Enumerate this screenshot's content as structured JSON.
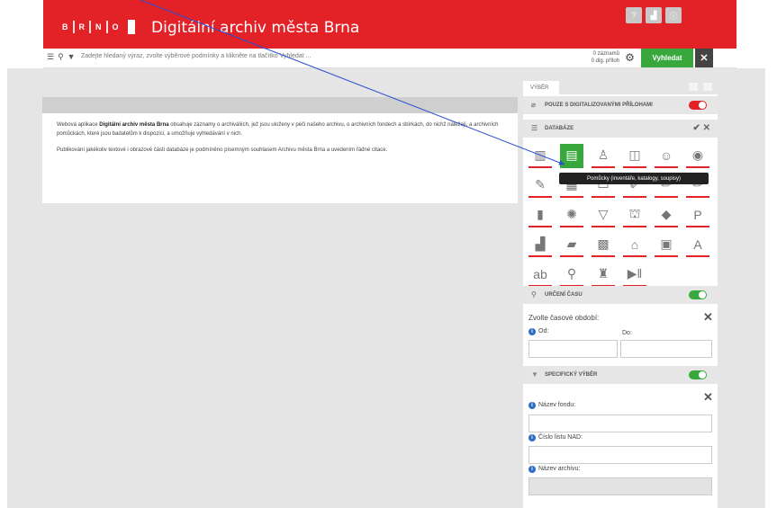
{
  "header": {
    "logo": [
      "B",
      "R",
      "N",
      "O"
    ],
    "title": "Digitální archiv města Brna",
    "icons": [
      "help-icon",
      "stats-icon",
      "info-icon"
    ]
  },
  "search": {
    "placeholder": "Zadejte hledaný výraz, zvolte výběrové podmínky a klikněte na tlačítko Vyhledat ...",
    "records": "0 záznamů",
    "attachments": "0 dig. příloh",
    "button": "Vyhledat",
    "close": "✕"
  },
  "intro": {
    "p1_a": "Webová aplikace ",
    "p1_b": "Digitální archiv města Brna",
    "p1_c": " obsahuje záznamy o archiváliích, jež jsou uloženy v péči našeho archivu, o archivních fondech a sbírkách, do nichž náležejí, a archivních pomůckách, které jsou badatelům k dispozici, a umožňuje vyhledávání v nich.",
    "p2": "Publikování jakékoliv textové i obrazové části databáze je podmíněno písemným souhlasem Archivu města Brna a uvedením řádné citace."
  },
  "panel": {
    "tab": "VÝBĚR",
    "digital_only": "POUZE S DIGITALIZOVANÝMI PŘÍLOHAMI",
    "databases": "DATABÁZE",
    "tooltip": "Pomůcky (inventáře, katalogy, soupisy)",
    "db_icons": [
      {
        "icon": "archive-icon",
        "glyph": "▥",
        "active": false
      },
      {
        "icon": "document-icon",
        "glyph": "▤",
        "active": true
      },
      {
        "icon": "person-icon",
        "glyph": "♙",
        "active": false
      },
      {
        "icon": "card-icon",
        "glyph": "◫",
        "active": false
      },
      {
        "icon": "people-icon",
        "glyph": "☺",
        "active": false
      },
      {
        "icon": "camera-icon",
        "glyph": "◉",
        "active": false
      },
      {
        "icon": "brush-icon",
        "glyph": "✎",
        "active": false
      },
      {
        "icon": "stack-icon",
        "glyph": "▦",
        "active": false
      },
      {
        "icon": "box-icon",
        "glyph": "▭",
        "active": false
      },
      {
        "icon": "pen-icon",
        "glyph": "✐",
        "active": false
      },
      {
        "icon": "pencil-icon",
        "glyph": "✏",
        "active": false
      },
      {
        "icon": "pencil-8k-icon",
        "glyph": "✏",
        "active": false
      },
      {
        "icon": "scroll-icon",
        "glyph": "▮",
        "active": false
      },
      {
        "icon": "seal-icon",
        "glyph": "✺",
        "active": false
      },
      {
        "icon": "badge-icon",
        "glyph": "▽",
        "active": false
      },
      {
        "icon": "gate-icon",
        "glyph": "⛫",
        "active": false
      },
      {
        "icon": "emblem-icon",
        "glyph": "◆",
        "active": false
      },
      {
        "icon": "poster-p-icon",
        "glyph": "P",
        "active": false
      },
      {
        "icon": "map-icon",
        "glyph": "▟",
        "active": false
      },
      {
        "icon": "book-icon",
        "glyph": "▰",
        "active": false
      },
      {
        "icon": "plan-icon",
        "glyph": "▩",
        "active": false
      },
      {
        "icon": "building-icon",
        "glyph": "⌂",
        "active": false
      },
      {
        "icon": "frame-icon",
        "glyph": "▣",
        "active": false
      },
      {
        "icon": "letter-a-icon",
        "glyph": "A",
        "active": false
      },
      {
        "icon": "handwriting-icon",
        "glyph": "ab",
        "active": false
      },
      {
        "icon": "tool-icon",
        "glyph": "⚲",
        "active": false
      },
      {
        "icon": "stamp-icon",
        "glyph": "♜",
        "active": false
      },
      {
        "icon": "media-play-icon",
        "glyph": "▶‖",
        "active": false
      }
    ],
    "time": "URČENÍ ČASU",
    "time_hint": "Zvolte časové období:",
    "from": "Od:",
    "to": "Do:",
    "specific": "SPECIFICKÝ VÝBĚR",
    "fund_name": "Název fondu:",
    "nad_number": "Číslo listu NAD:",
    "archive_name": "Název archivu:"
  }
}
